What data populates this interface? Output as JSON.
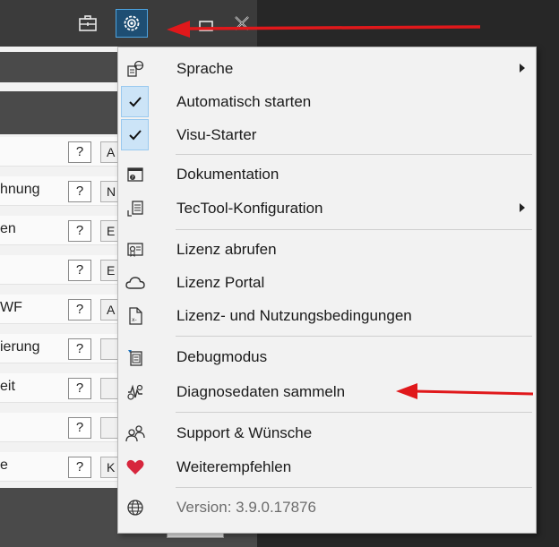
{
  "app": {
    "rows": [
      {
        "label": "",
        "sel": "A"
      },
      {
        "label": "hnung",
        "sel": "N"
      },
      {
        "label": "en",
        "sel": "E"
      },
      {
        "label": "",
        "sel": "E"
      },
      {
        "label": "WF",
        "sel": "A"
      },
      {
        "label": "ierung",
        "sel": ""
      },
      {
        "label": "eit",
        "sel": ""
      },
      {
        "label": "",
        "sel": ""
      },
      {
        "label": "e",
        "sel": "K"
      }
    ],
    "help_label": "?",
    "language_button": "⊕ ˅"
  },
  "menu": {
    "items": [
      {
        "label": "Sprache",
        "icon": "language-icon",
        "submenu": true
      },
      {
        "label": "Automatisch starten",
        "icon": "checkmark-icon",
        "checked": true
      },
      {
        "label": "Visu-Starter",
        "icon": "checkmark-icon",
        "checked": true
      },
      {
        "label": "Dokumentation",
        "icon": "documentation-icon"
      },
      {
        "label": "TecTool-Konfiguration",
        "icon": "configuration-icon",
        "submenu": true
      },
      {
        "label": "Lizenz abrufen",
        "icon": "license-icon"
      },
      {
        "label": "Lizenz Portal",
        "icon": "cloud-icon"
      },
      {
        "label": "Lizenz- und Nutzungsbedingungen",
        "icon": "terms-document-icon"
      },
      {
        "label": "Debugmodus",
        "icon": "debug-icon"
      },
      {
        "label": "Diagnosedaten sammeln",
        "icon": "diagnostics-icon"
      },
      {
        "label": "Support & Wünsche",
        "icon": "support-people-icon"
      },
      {
        "label": "Weiterempfehlen",
        "icon": "heart-icon"
      },
      {
        "label": "Version: 3.9.0.17876",
        "icon": "globe-icon",
        "disabled": true
      }
    ]
  },
  "colors": {
    "accent": "#4da3e0",
    "annotation_arrow": "#e0181b",
    "heart": "#d7263d"
  }
}
